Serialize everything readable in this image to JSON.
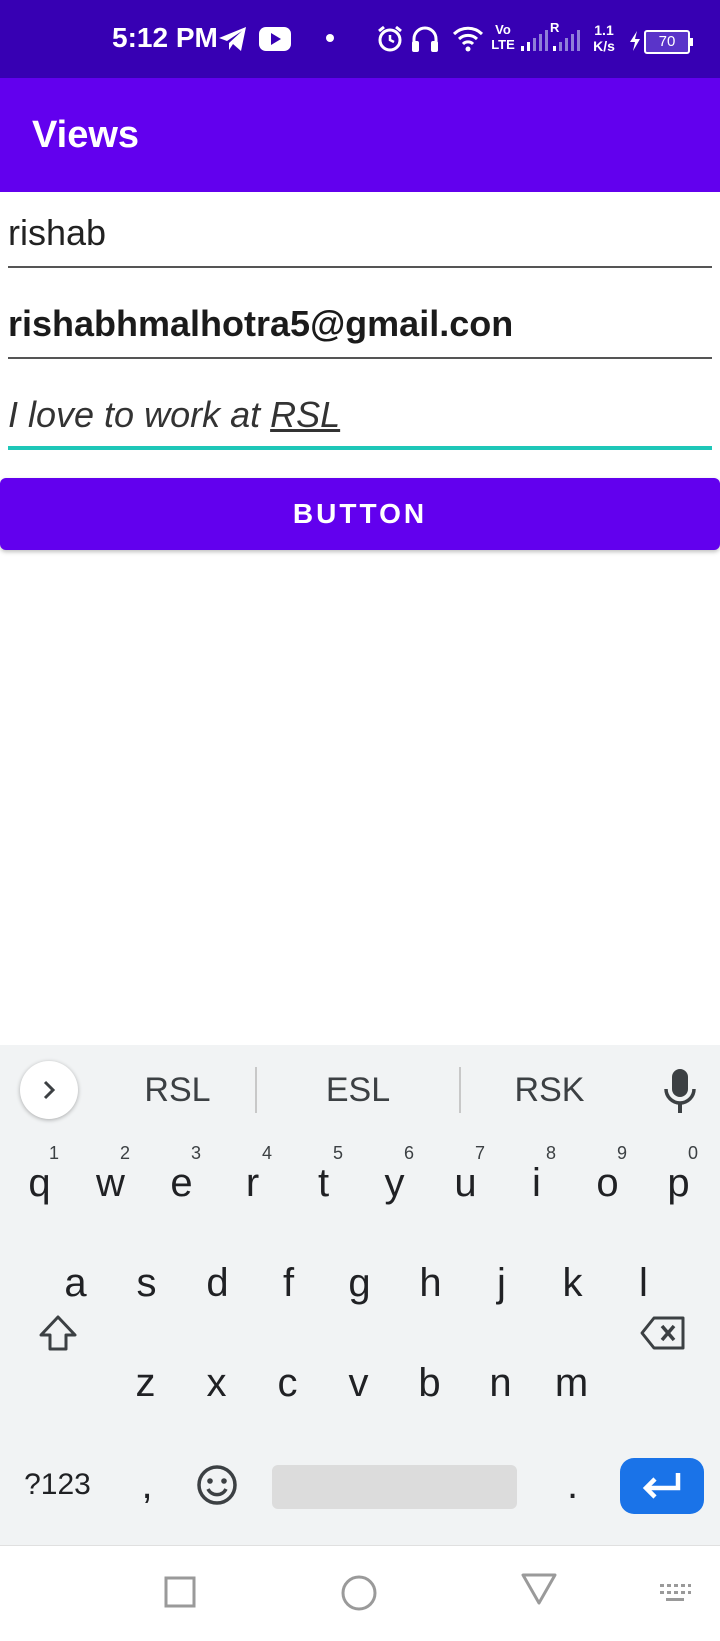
{
  "status_bar": {
    "time": "5:12 PM",
    "net_speed_value": "1.1",
    "net_speed_unit": "K/s",
    "battery": "70",
    "volte_line1": "Vo",
    "volte_line2": "LTE",
    "roaming": "R",
    "icons": [
      "telegram-icon",
      "youtube-icon",
      "dot-icon",
      "alarm-icon",
      "headphones-icon",
      "wifi-icon",
      "volte-icon",
      "signal-icon",
      "signal-roaming-icon",
      "net-speed",
      "charging-icon",
      "battery-icon"
    ]
  },
  "app_bar": {
    "title": "Views"
  },
  "form": {
    "name_value": "rishab",
    "email_value": "rishabhmalhotra5@gmail.con",
    "message_prefix": "I love to work at ",
    "message_underlined": "RSL",
    "button_label": "BUTTON",
    "focus_color": "#1ec7b8",
    "accent_color": "#6200ee"
  },
  "keyboard": {
    "suggestions": [
      "RSL",
      "ESL",
      "RSK"
    ],
    "row1": [
      "q",
      "w",
      "e",
      "r",
      "t",
      "y",
      "u",
      "i",
      "o",
      "p"
    ],
    "row1_hints": [
      "1",
      "2",
      "3",
      "4",
      "5",
      "6",
      "7",
      "8",
      "9",
      "0"
    ],
    "row2": [
      "a",
      "s",
      "d",
      "f",
      "g",
      "h",
      "j",
      "k",
      "l"
    ],
    "row3": [
      "z",
      "x",
      "c",
      "v",
      "b",
      "n",
      "m"
    ],
    "symbols_label": "?123",
    "comma": ",",
    "period": ".",
    "enter_color": "#1a73e8"
  },
  "nav_bar": {
    "icons": [
      "recent-apps-icon",
      "home-icon",
      "back-icon",
      "keyboard-switch-icon"
    ]
  }
}
